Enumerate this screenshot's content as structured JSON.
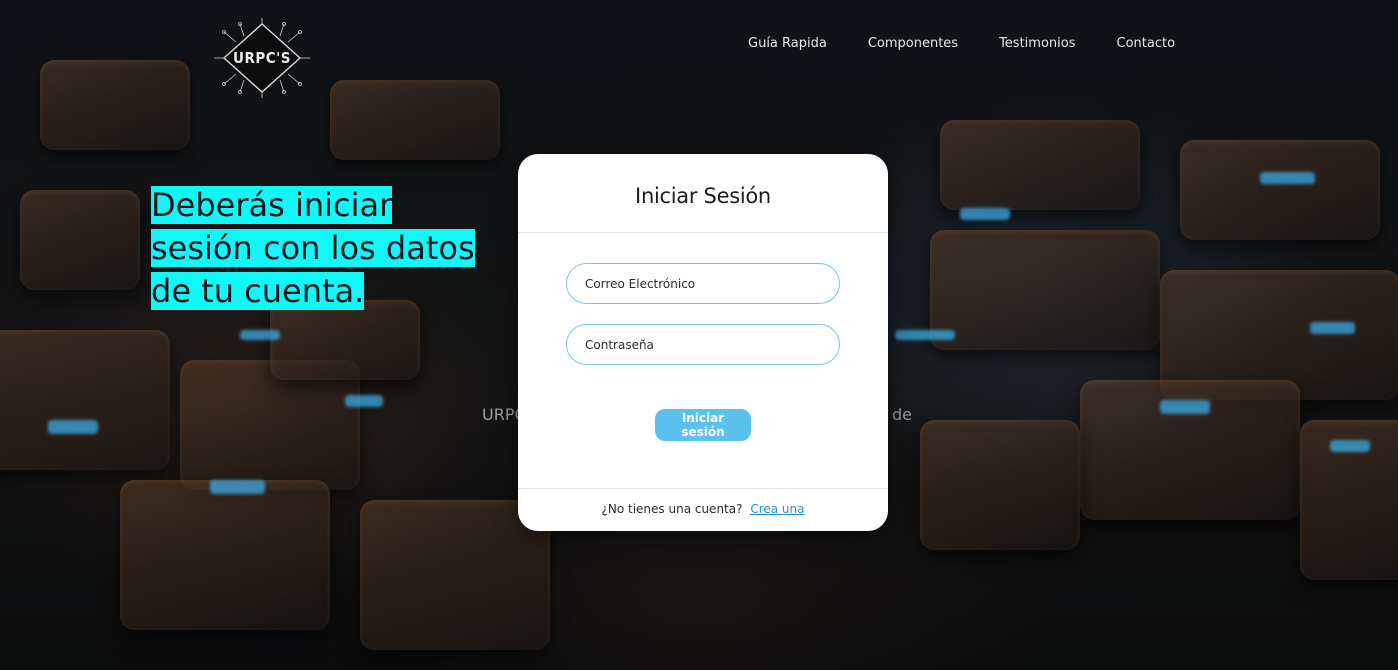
{
  "logo": {
    "text": "URPC'S"
  },
  "nav": {
    "items": [
      "Guía Rapida",
      "Componentes",
      "Testimonios",
      "Contacto"
    ]
  },
  "background": {
    "text_left": "URPC",
    "text_right": "de"
  },
  "caption": {
    "text": "Deberás iniciar sesión con los datos de tu cuenta."
  },
  "login": {
    "title": "Iniciar Sesión",
    "email_placeholder": "Correo Electrónico",
    "password_placeholder": "Contraseña",
    "submit_label": "Iniciar sesión",
    "no_account_text": "¿No tienes una cuenta?",
    "create_link": "Crea una"
  },
  "colors": {
    "accent": "#5bc0eb",
    "field_border": "#7ec3e6",
    "caption_highlight": "#0ff7f7",
    "link": "#2b8fd6"
  }
}
